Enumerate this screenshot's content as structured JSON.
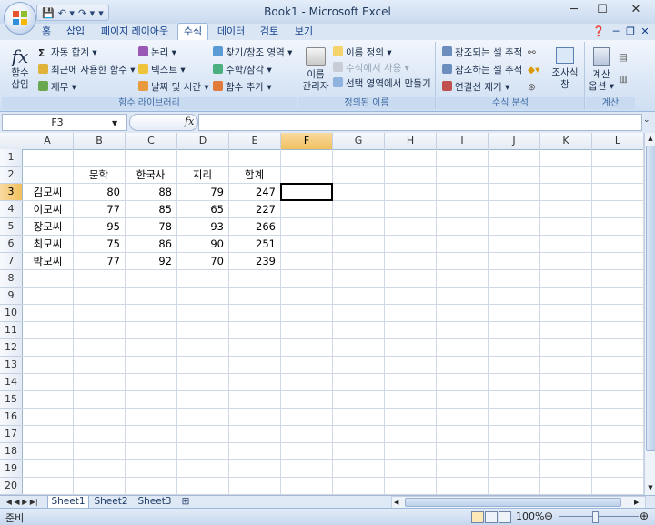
{
  "window": {
    "title": "Book1 - Microsoft Excel"
  },
  "qat": {
    "save": "💾",
    "undo": "↶ ▾",
    "redo": "↷ ▾",
    "customize": "▾"
  },
  "tabs": [
    {
      "label": "홈"
    },
    {
      "label": "삽입"
    },
    {
      "label": "페이지 레이아웃"
    },
    {
      "label": "수식"
    },
    {
      "label": "데이터"
    },
    {
      "label": "검토"
    },
    {
      "label": "보기"
    }
  ],
  "active_tab": "수식",
  "ribbon": {
    "function_library": {
      "label": "함수 라이브러리",
      "insert_function": "함수\n삽입",
      "autosum": "자동 합계 ▾",
      "recent": "최근에 사용한 함수 ▾",
      "financial": "재무 ▾",
      "logical": "논리 ▾",
      "text": "텍스트 ▾",
      "datetime": "날짜 및 시간 ▾",
      "lookup": "찾기/참조 영역 ▾",
      "math": "수학/삼각 ▾",
      "more": "함수 추가 ▾"
    },
    "defined_names": {
      "label": "정의된 이름",
      "name_manager": "이름\n관리자",
      "define_name": "이름 정의 ▾",
      "use_in_formula": "수식에서 사용 ▾",
      "create_from_selection": "선택 영역에서 만들기"
    },
    "formula_auditing": {
      "label": "수식 분석",
      "trace_precedents": "참조되는 셀 추적",
      "trace_dependents": "참조하는 셀 추적",
      "remove_arrows": "연결선 제거 ▾",
      "watch_window": "조사식\n창"
    },
    "calculation": {
      "label": "계산",
      "options": "계산\n옵션 ▾"
    }
  },
  "formula_bar": {
    "name_box": "F3",
    "fx": "fx",
    "formula": ""
  },
  "columns": [
    "A",
    "B",
    "C",
    "D",
    "E",
    "F",
    "G",
    "H",
    "I",
    "J",
    "K",
    "L"
  ],
  "rows": [
    1,
    2,
    3,
    4,
    5,
    6,
    7,
    8,
    9,
    10,
    11,
    12,
    13,
    14,
    15,
    16,
    17,
    18,
    19,
    20
  ],
  "selected_cell": "F3",
  "sheet": {
    "headers": [
      "문학",
      "한국사",
      "지리",
      "합계"
    ],
    "records": [
      {
        "name": "김모씨",
        "vals": [
          "80",
          "88",
          "79",
          "247"
        ]
      },
      {
        "name": "이모씨",
        "vals": [
          "77",
          "85",
          "65",
          "227"
        ]
      },
      {
        "name": "장모씨",
        "vals": [
          "95",
          "78",
          "93",
          "266"
        ]
      },
      {
        "name": "최모씨",
        "vals": [
          "75",
          "86",
          "90",
          "251"
        ]
      },
      {
        "name": "박모씨",
        "vals": [
          "77",
          "92",
          "70",
          "239"
        ]
      }
    ]
  },
  "sheet_tabs": [
    {
      "label": "Sheet1"
    },
    {
      "label": "Sheet2"
    },
    {
      "label": "Sheet3"
    }
  ],
  "active_sheet": "Sheet1",
  "status": {
    "ready": "준비",
    "zoom": "100%"
  }
}
